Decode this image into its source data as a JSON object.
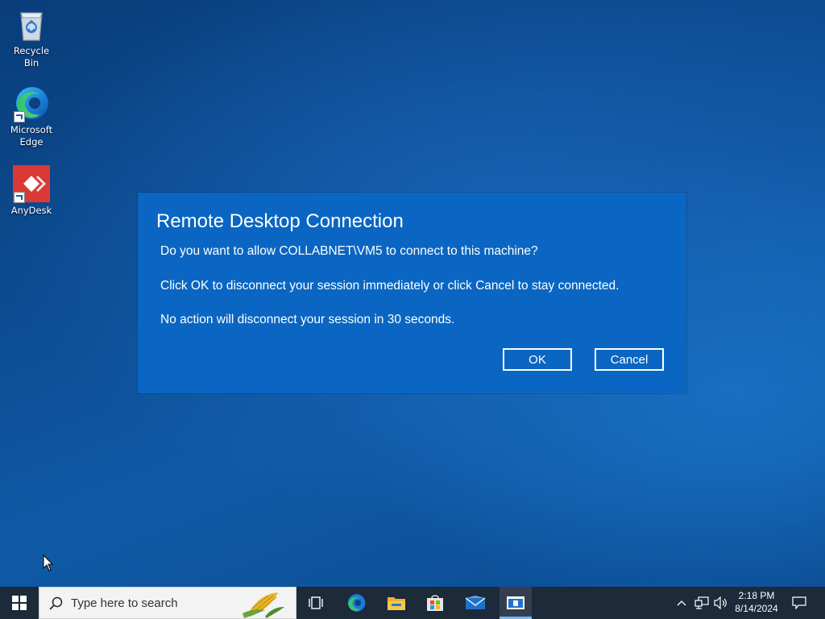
{
  "desktop": {
    "icons": [
      {
        "label": "Recycle Bin",
        "icon": "recycle-bin-icon"
      },
      {
        "label": "Microsoft Edge",
        "icon": "edge-icon"
      },
      {
        "label": "AnyDesk",
        "icon": "anydesk-icon"
      }
    ]
  },
  "dialog": {
    "title": "Remote Desktop Connection",
    "line1": "Do you want to allow COLLABNET\\VM5 to connect to this machine?",
    "line2": "Click OK to disconnect your session immediately or click Cancel to stay connected.",
    "line3": "No action will disconnect your session in 30 seconds.",
    "ok_label": "OK",
    "cancel_label": "Cancel",
    "background": "#0a66c2"
  },
  "taskbar": {
    "search_placeholder": "Type here to search",
    "apps": [
      "task-view-icon",
      "edge-icon",
      "file-explorer-icon",
      "store-icon",
      "mail-icon",
      "remote-desktop-icon"
    ],
    "active_app": "remote-desktop-icon",
    "tray_icons": [
      "chevron-up-icon",
      "network-icon",
      "volume-icon",
      "notification-icon"
    ],
    "time": "2:18 PM",
    "date": "8/14/2024",
    "background": "#1c2a3a"
  }
}
